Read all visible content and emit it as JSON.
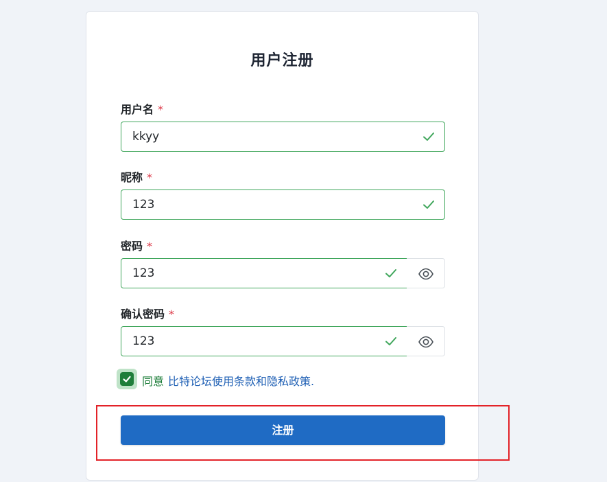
{
  "form": {
    "title": "用户注册",
    "required_mark": "*",
    "fields": [
      {
        "label": "用户名",
        "value": "kkyy",
        "valid": true
      },
      {
        "label": "昵称",
        "value": "123",
        "valid": true
      },
      {
        "label": "密码",
        "value": "123",
        "valid": true,
        "icon": "eye-icon"
      },
      {
        "label": "确认密码",
        "value": "123",
        "valid": true,
        "icon": "eye-icon"
      }
    ],
    "agree": {
      "checked": true,
      "label": "同意",
      "terms_link": "比特论坛使用条款和隐私政策."
    },
    "submit_label": "注册"
  },
  "colors": {
    "valid_green": "#3fa65b",
    "primary_blue": "#1f6bc4",
    "required_red": "#dc3545",
    "annotation_red": "#e32228"
  }
}
